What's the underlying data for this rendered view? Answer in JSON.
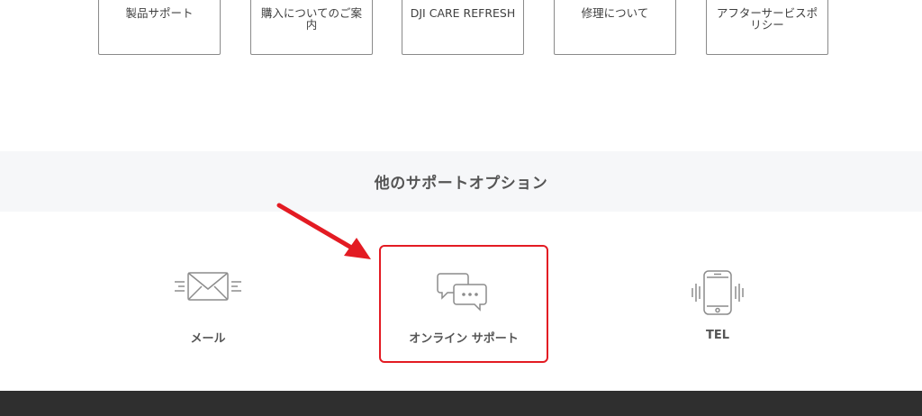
{
  "top_cards": [
    {
      "label": "製品サポート"
    },
    {
      "label": "購入についてのご案内"
    },
    {
      "label": "DJI CARE REFRESH"
    },
    {
      "label": "修理について"
    },
    {
      "label": "アフターサービスポリシー"
    }
  ],
  "section": {
    "title": "他のサポートオプション"
  },
  "options": [
    {
      "label": "メール",
      "icon": "mail-icon"
    },
    {
      "label": "オンライン サポート",
      "icon": "chat-bubbles-icon"
    },
    {
      "label": "TEL",
      "icon": "phone-icon"
    }
  ],
  "colors": {
    "highlight": "#e31b23",
    "band_background": "#f6f7f9",
    "footer_background": "#2f2f2f",
    "icon_gray": "#8c8c8c"
  }
}
